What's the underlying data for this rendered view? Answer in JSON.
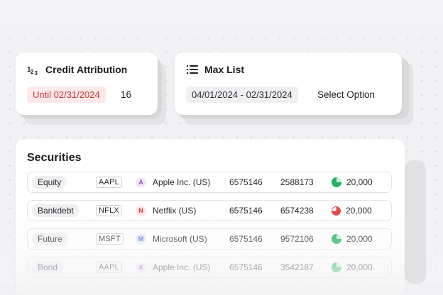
{
  "credit_card": {
    "title": "Credit Attribution",
    "icon": "numbers-icon",
    "date_pill": "Until 02/31/2024",
    "count": "16"
  },
  "max_list_card": {
    "title": "Max List",
    "icon": "list-icon",
    "date_range": "04/01/2024 - 02/31/2024",
    "select_label": "Select Option"
  },
  "securities": {
    "title": "Securities",
    "rows": [
      {
        "type": "Equity",
        "ticker": "AAPL",
        "avatar": "A",
        "avatar_color": "#f3e4fb",
        "avatar_text_color": "#a24bd0",
        "name": "Apple Inc. (US)",
        "col1": "6575146",
        "col2": "2588173",
        "pie": "green",
        "value": "20,000"
      },
      {
        "type": "Bankdebt",
        "ticker": "NFLX",
        "avatar": "N",
        "avatar_color": "#fde6e6",
        "avatar_text_color": "#d43a3a",
        "name": "Netflix (US)",
        "col1": "6575146",
        "col2": "6574238",
        "pie": "red",
        "value": "20,000"
      },
      {
        "type": "Future",
        "ticker": "MSFT",
        "avatar": "M",
        "avatar_color": "#e3ebfb",
        "avatar_text_color": "#4a6fd0",
        "name": "Microsoft (US)",
        "col1": "6575146",
        "col2": "9572106",
        "pie": "green",
        "value": "20,000"
      },
      {
        "type": "Bond",
        "ticker": "AAPL",
        "avatar": "A",
        "avatar_color": "#f3e4fb",
        "avatar_text_color": "#a24bd0",
        "name": "Apple Inc. (US)",
        "col1": "6575146",
        "col2": "3542187",
        "pie": "green",
        "value": "20,000"
      }
    ]
  },
  "colors": {
    "green": "#23b35a",
    "red": "#e54848",
    "accent_red_bg": "#fde9e9",
    "accent_red_text": "#c93535"
  }
}
